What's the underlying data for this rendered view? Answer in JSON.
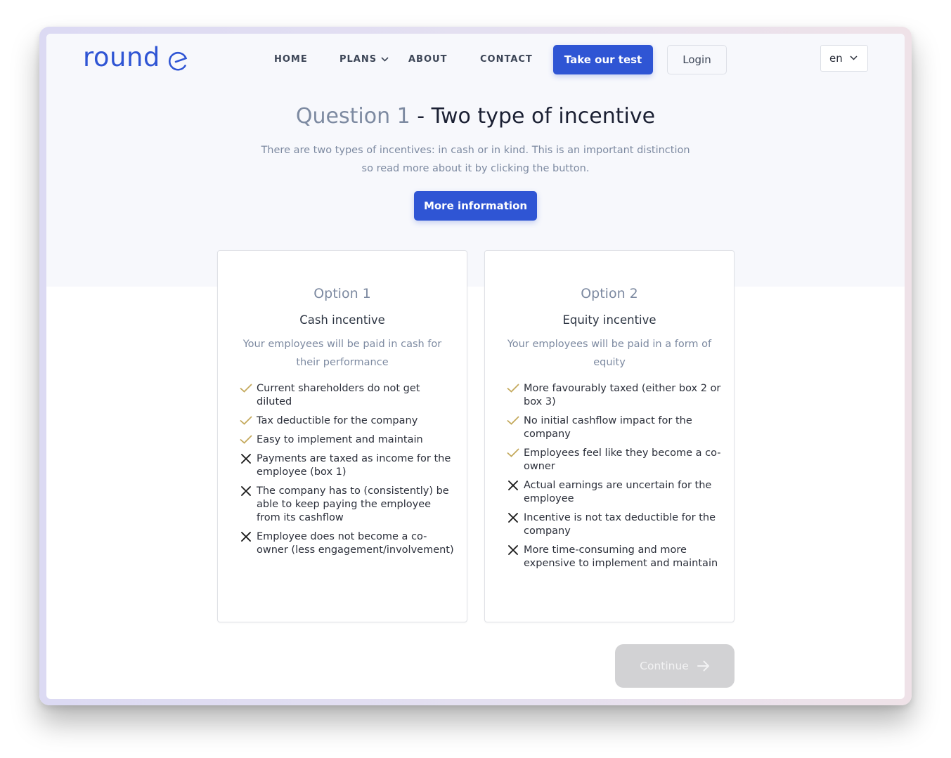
{
  "brand": {
    "name": "round",
    "accent_color": "#2f55d4"
  },
  "nav": {
    "links": [
      {
        "label": "HOME"
      },
      {
        "label": "PLANS",
        "has_dropdown": true
      },
      {
        "label": "ABOUT"
      },
      {
        "label": "CONTACT"
      }
    ],
    "cta_label": "Take our test",
    "login_label": "Login",
    "language": "en"
  },
  "question": {
    "number_label": "Question 1",
    "separator": " - ",
    "title": "Two type of incentive",
    "description": "There are two types of incentives: in cash or in kind. This is an important distinction so read more about it by clicking the button.",
    "more_info_label": "More information"
  },
  "options": [
    {
      "option_label": "Option 1",
      "title": "Cash incentive",
      "description": "Your employees will be paid in cash for their performance",
      "points": [
        {
          "type": "pro",
          "text": "Current shareholders do not get diluted"
        },
        {
          "type": "pro",
          "text": "Tax deductible for the company"
        },
        {
          "type": "pro",
          "text": "Easy to implement and maintain"
        },
        {
          "type": "con",
          "text": "Payments are taxed as income for the employee (box 1)"
        },
        {
          "type": "con",
          "text": "The company has to (consistently) be able to keep paying the employee from its cashflow"
        },
        {
          "type": "con",
          "text": "Employee does not become a co-owner (less engagement/involvement)"
        }
      ]
    },
    {
      "option_label": "Option 2",
      "title": "Equity incentive",
      "description": "Your employees will be paid in a form of equity",
      "points": [
        {
          "type": "pro",
          "text": "More favourably taxed (either box 2 or box 3)"
        },
        {
          "type": "pro",
          "text": "No initial cashflow impact for the company"
        },
        {
          "type": "pro",
          "text": "Employees feel like they become a co-owner"
        },
        {
          "type": "con",
          "text": "Actual earnings are uncertain for the employee"
        },
        {
          "type": "con",
          "text": "Incentive is not tax deductible for the company"
        },
        {
          "type": "con",
          "text": "More time-consuming and more expensive to implement and maintain"
        }
      ]
    }
  ],
  "continue": {
    "label": "Continue",
    "disabled": true
  },
  "colors": {
    "pro_check": "#c4a95c",
    "con_cross": "#1b1b1b",
    "disabled_button": "#d2d2d4"
  }
}
